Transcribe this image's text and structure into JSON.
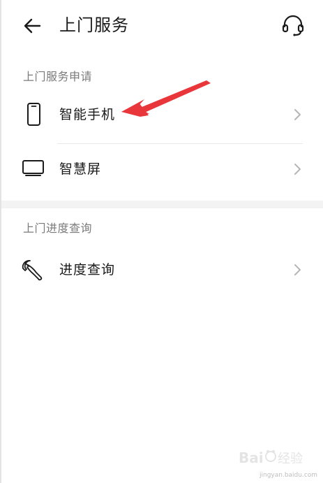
{
  "header": {
    "title": "上门服务",
    "back_icon": "arrow-left-icon",
    "service_icon": "headset-icon"
  },
  "sections": [
    {
      "label": "上门服务申请",
      "items": [
        {
          "label": "智能手机",
          "icon": "smartphone-icon"
        },
        {
          "label": "智慧屏",
          "icon": "smart-screen-icon"
        }
      ]
    },
    {
      "label": "上门进度查询",
      "items": [
        {
          "label": "进度查询",
          "icon": "wrench-icon"
        }
      ]
    }
  ],
  "annotation": {
    "color": "#e8363a",
    "points_to": "智能手机"
  },
  "watermark": {
    "text": "Baidu 经验",
    "url": "jingyan.baidu.com"
  }
}
